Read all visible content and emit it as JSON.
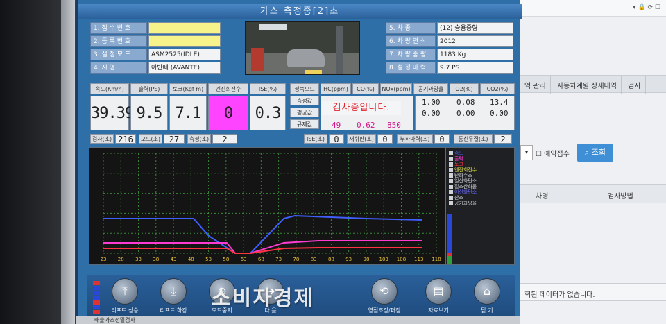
{
  "app": {
    "title": "가스 측정중[2]초"
  },
  "vehicle_info_left": [
    {
      "label": "1. 접 수 번 호",
      "value": ""
    },
    {
      "label": "2. 등 록 번 호",
      "value": ""
    },
    {
      "label": "3. 설 정 모 드",
      "value": "ASM2525(IDLE)"
    },
    {
      "label": "4. 시        명",
      "value": "아반떼 (AVANTE)"
    }
  ],
  "vehicle_info_right": [
    {
      "label": "5. 차        종",
      "value": "(12) 승용중형"
    },
    {
      "label": "6. 차 량 연 식",
      "value": "2012"
    },
    {
      "label": "7. 차 량 중 량",
      "value": "1183     Kg"
    },
    {
      "label": "8. 설 정 마 력",
      "value": "9.7       PS"
    }
  ],
  "measures": {
    "speed_label": "속도(Km/h)",
    "speed_value": "39.39",
    "output_label": "출력(PS)",
    "output_value": "9.5",
    "torque_label": "토크(Kgf m)",
    "torque_value": "7.1",
    "rpm_label": "엔진회전수",
    "rpm_value": "0",
    "ise_label": "ISE(%)",
    "ise_value": "0.3"
  },
  "gas_table": {
    "headers": [
      "정속모드",
      "HC(ppm)",
      "CO(%)",
      "NOx(ppm)",
      "공기과잉율",
      "O2(%)",
      "CO2(%)"
    ],
    "rows": [
      "측정값",
      "평균값",
      "규제값"
    ],
    "status_message": "검사중입니다.",
    "limit_values": [
      "49",
      "0.62",
      "850"
    ],
    "air_excess": [
      "1.00",
      "0.00"
    ],
    "o2": [
      "0.08",
      "0.00"
    ],
    "co2": [
      "13.4",
      "0.00"
    ]
  },
  "timers": {
    "check_label": "검사(초)",
    "check_value": "216",
    "mode_label": "모드(초)",
    "mode_value": "27",
    "measure_label": "측정(초)",
    "measure_value": "2",
    "ise_label": "ISE(초)",
    "ise_value": "0",
    "adjust_label": "재쉬판(초)",
    "adjust_value": "0",
    "load_label": "부하마력(초)",
    "load_value": "0",
    "comm_label": "통신두절(초)",
    "comm_value": "2"
  },
  "graph": {
    "x_ticks": [
      "23",
      "28",
      "33",
      "38",
      "43",
      "48",
      "53",
      "58",
      "63",
      "68",
      "73",
      "78",
      "83",
      "88",
      "93",
      "98",
      "103",
      "108",
      "113",
      "118"
    ],
    "legend": [
      {
        "label": "속도",
        "color": "#3f5fff"
      },
      {
        "label": "출력",
        "color": "#ff3bd4"
      },
      {
        "label": "토크",
        "color": "#ff3344"
      },
      {
        "label": "엔진회전수",
        "color": "#e8e84a"
      },
      {
        "label": "탄화수소",
        "color": "#cfd3d8"
      },
      {
        "label": "일산화탄소",
        "color": "#cfd3d8"
      },
      {
        "label": "질소산화물",
        "color": "#cfd3d8"
      },
      {
        "label": "이산화탄소",
        "color": "#6a6aff"
      },
      {
        "label": "산소",
        "color": "#cfd3d8"
      },
      {
        "label": "공기과잉율",
        "color": "#cfd3d8"
      }
    ]
  },
  "toolbar": {
    "buttons": [
      {
        "label": "리프트 상승"
      },
      {
        "label": "리프트 하강"
      },
      {
        "label": "모드중지"
      },
      {
        "label": "다 음"
      },
      {
        "label": "영점조정/퍼징"
      },
      {
        "label": "자료보기"
      },
      {
        "label": "닫 기"
      }
    ]
  },
  "background_window": {
    "tabs": [
      "억 관리",
      "자동차계원 상세내역",
      "검사"
    ],
    "reservation_label": "예약접수",
    "search_label": "조회",
    "columns": [
      "차명",
      "검사방법"
    ],
    "no_data": "회된 데이터가 없습니다.",
    "bottom_tree_item": "배출가스정밀검사"
  },
  "watermark": "소비자경제"
}
